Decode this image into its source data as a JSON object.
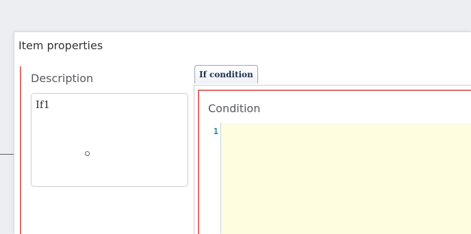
{
  "panel": {
    "title": "Item properties"
  },
  "description": {
    "label": "Description",
    "value": "If1"
  },
  "tabs": [
    {
      "label": "If condition",
      "selected": true
    }
  ],
  "condition": {
    "label": "Condition",
    "line_numbers": [
      "1"
    ],
    "code": ""
  },
  "colors": {
    "accent_error": "#e06b6b",
    "editor_background": "#fffde0",
    "line_number": "#2e8a97",
    "tab_text": "#1d2f4f"
  },
  "icons": {
    "connector": "connector-endpoint-icon"
  }
}
